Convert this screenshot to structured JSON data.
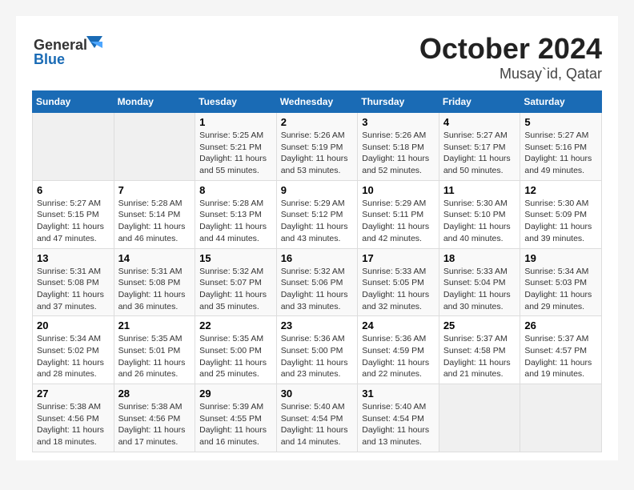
{
  "header": {
    "logo_line1": "General",
    "logo_line2": "Blue",
    "month": "October 2024",
    "location": "Musay`id, Qatar"
  },
  "days_of_week": [
    "Sunday",
    "Monday",
    "Tuesday",
    "Wednesday",
    "Thursday",
    "Friday",
    "Saturday"
  ],
  "weeks": [
    [
      {
        "day": "",
        "sunrise": "",
        "sunset": "",
        "daylight": "",
        "empty": true
      },
      {
        "day": "",
        "sunrise": "",
        "sunset": "",
        "daylight": "",
        "empty": true
      },
      {
        "day": "1",
        "sunrise": "Sunrise: 5:25 AM",
        "sunset": "Sunset: 5:21 PM",
        "daylight": "Daylight: 11 hours and 55 minutes."
      },
      {
        "day": "2",
        "sunrise": "Sunrise: 5:26 AM",
        "sunset": "Sunset: 5:19 PM",
        "daylight": "Daylight: 11 hours and 53 minutes."
      },
      {
        "day": "3",
        "sunrise": "Sunrise: 5:26 AM",
        "sunset": "Sunset: 5:18 PM",
        "daylight": "Daylight: 11 hours and 52 minutes."
      },
      {
        "day": "4",
        "sunrise": "Sunrise: 5:27 AM",
        "sunset": "Sunset: 5:17 PM",
        "daylight": "Daylight: 11 hours and 50 minutes."
      },
      {
        "day": "5",
        "sunrise": "Sunrise: 5:27 AM",
        "sunset": "Sunset: 5:16 PM",
        "daylight": "Daylight: 11 hours and 49 minutes."
      }
    ],
    [
      {
        "day": "6",
        "sunrise": "Sunrise: 5:27 AM",
        "sunset": "Sunset: 5:15 PM",
        "daylight": "Daylight: 11 hours and 47 minutes."
      },
      {
        "day": "7",
        "sunrise": "Sunrise: 5:28 AM",
        "sunset": "Sunset: 5:14 PM",
        "daylight": "Daylight: 11 hours and 46 minutes."
      },
      {
        "day": "8",
        "sunrise": "Sunrise: 5:28 AM",
        "sunset": "Sunset: 5:13 PM",
        "daylight": "Daylight: 11 hours and 44 minutes."
      },
      {
        "day": "9",
        "sunrise": "Sunrise: 5:29 AM",
        "sunset": "Sunset: 5:12 PM",
        "daylight": "Daylight: 11 hours and 43 minutes."
      },
      {
        "day": "10",
        "sunrise": "Sunrise: 5:29 AM",
        "sunset": "Sunset: 5:11 PM",
        "daylight": "Daylight: 11 hours and 42 minutes."
      },
      {
        "day": "11",
        "sunrise": "Sunrise: 5:30 AM",
        "sunset": "Sunset: 5:10 PM",
        "daylight": "Daylight: 11 hours and 40 minutes."
      },
      {
        "day": "12",
        "sunrise": "Sunrise: 5:30 AM",
        "sunset": "Sunset: 5:09 PM",
        "daylight": "Daylight: 11 hours and 39 minutes."
      }
    ],
    [
      {
        "day": "13",
        "sunrise": "Sunrise: 5:31 AM",
        "sunset": "Sunset: 5:08 PM",
        "daylight": "Daylight: 11 hours and 37 minutes."
      },
      {
        "day": "14",
        "sunrise": "Sunrise: 5:31 AM",
        "sunset": "Sunset: 5:08 PM",
        "daylight": "Daylight: 11 hours and 36 minutes."
      },
      {
        "day": "15",
        "sunrise": "Sunrise: 5:32 AM",
        "sunset": "Sunset: 5:07 PM",
        "daylight": "Daylight: 11 hours and 35 minutes."
      },
      {
        "day": "16",
        "sunrise": "Sunrise: 5:32 AM",
        "sunset": "Sunset: 5:06 PM",
        "daylight": "Daylight: 11 hours and 33 minutes."
      },
      {
        "day": "17",
        "sunrise": "Sunrise: 5:33 AM",
        "sunset": "Sunset: 5:05 PM",
        "daylight": "Daylight: 11 hours and 32 minutes."
      },
      {
        "day": "18",
        "sunrise": "Sunrise: 5:33 AM",
        "sunset": "Sunset: 5:04 PM",
        "daylight": "Daylight: 11 hours and 30 minutes."
      },
      {
        "day": "19",
        "sunrise": "Sunrise: 5:34 AM",
        "sunset": "Sunset: 5:03 PM",
        "daylight": "Daylight: 11 hours and 29 minutes."
      }
    ],
    [
      {
        "day": "20",
        "sunrise": "Sunrise: 5:34 AM",
        "sunset": "Sunset: 5:02 PM",
        "daylight": "Daylight: 11 hours and 28 minutes."
      },
      {
        "day": "21",
        "sunrise": "Sunrise: 5:35 AM",
        "sunset": "Sunset: 5:01 PM",
        "daylight": "Daylight: 11 hours and 26 minutes."
      },
      {
        "day": "22",
        "sunrise": "Sunrise: 5:35 AM",
        "sunset": "Sunset: 5:00 PM",
        "daylight": "Daylight: 11 hours and 25 minutes."
      },
      {
        "day": "23",
        "sunrise": "Sunrise: 5:36 AM",
        "sunset": "Sunset: 5:00 PM",
        "daylight": "Daylight: 11 hours and 23 minutes."
      },
      {
        "day": "24",
        "sunrise": "Sunrise: 5:36 AM",
        "sunset": "Sunset: 4:59 PM",
        "daylight": "Daylight: 11 hours and 22 minutes."
      },
      {
        "day": "25",
        "sunrise": "Sunrise: 5:37 AM",
        "sunset": "Sunset: 4:58 PM",
        "daylight": "Daylight: 11 hours and 21 minutes."
      },
      {
        "day": "26",
        "sunrise": "Sunrise: 5:37 AM",
        "sunset": "Sunset: 4:57 PM",
        "daylight": "Daylight: 11 hours and 19 minutes."
      }
    ],
    [
      {
        "day": "27",
        "sunrise": "Sunrise: 5:38 AM",
        "sunset": "Sunset: 4:56 PM",
        "daylight": "Daylight: 11 hours and 18 minutes."
      },
      {
        "day": "28",
        "sunrise": "Sunrise: 5:38 AM",
        "sunset": "Sunset: 4:56 PM",
        "daylight": "Daylight: 11 hours and 17 minutes."
      },
      {
        "day": "29",
        "sunrise": "Sunrise: 5:39 AM",
        "sunset": "Sunset: 4:55 PM",
        "daylight": "Daylight: 11 hours and 16 minutes."
      },
      {
        "day": "30",
        "sunrise": "Sunrise: 5:40 AM",
        "sunset": "Sunset: 4:54 PM",
        "daylight": "Daylight: 11 hours and 14 minutes."
      },
      {
        "day": "31",
        "sunrise": "Sunrise: 5:40 AM",
        "sunset": "Sunset: 4:54 PM",
        "daylight": "Daylight: 11 hours and 13 minutes."
      },
      {
        "day": "",
        "sunrise": "",
        "sunset": "",
        "daylight": "",
        "empty": true
      },
      {
        "day": "",
        "sunrise": "",
        "sunset": "",
        "daylight": "",
        "empty": true
      }
    ]
  ]
}
